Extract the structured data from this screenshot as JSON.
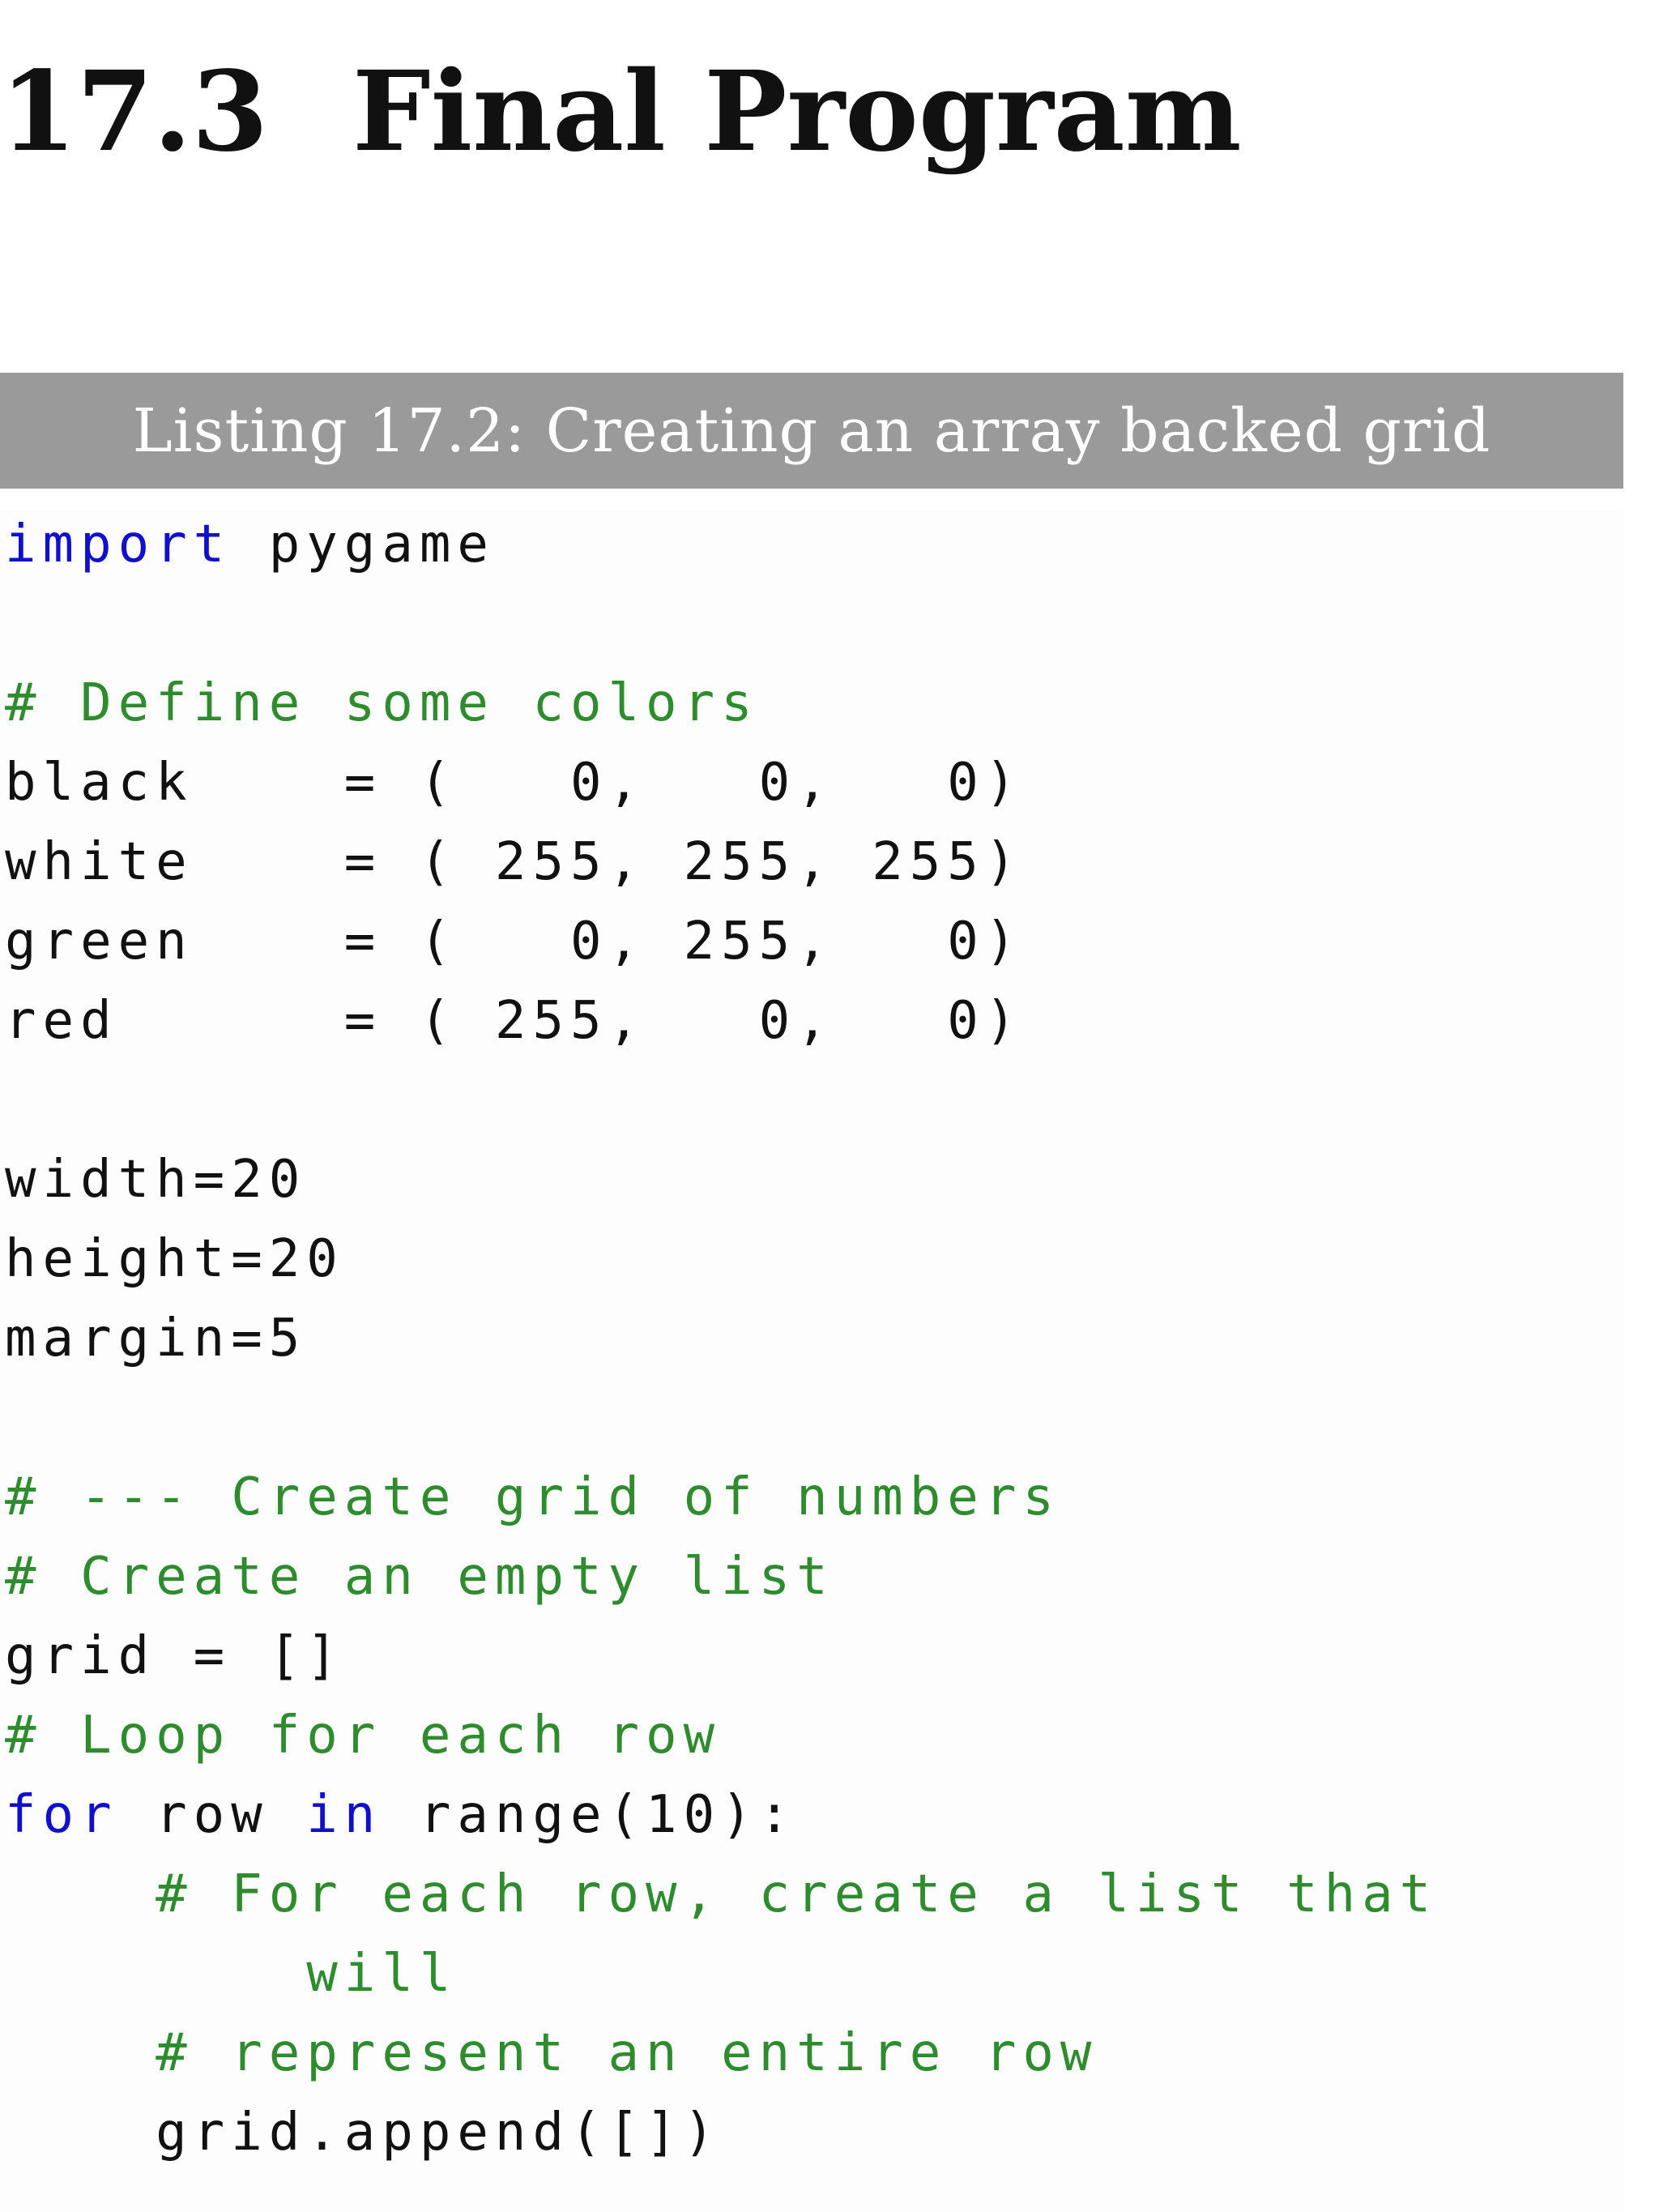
{
  "heading": {
    "number": "17.3",
    "title": "Final Program"
  },
  "listing": {
    "caption": "Listing 17.2: Creating an array backed grid"
  },
  "code": {
    "l01_kw": "import",
    "l01_rest": " pygame",
    "l02_cm": "# Define some colors",
    "l03": "black    = (   0,   0,   0)",
    "l04": "white    = ( 255, 255, 255)",
    "l05": "green    = (   0, 255,   0)",
    "l06": "red      = ( 255,   0,   0)",
    "l07": "width=20",
    "l08": "height=20",
    "l09": "margin=5",
    "l10_cm": "# --- Create grid of numbers",
    "l11_cm": "# Create an empty list",
    "l12": "grid = []",
    "l13_cm": "# Loop for each row",
    "l14_kw1": "for",
    "l14_mid": " row ",
    "l14_kw2": "in",
    "l14_rest": " range(10):",
    "l15_cm": "    # For each row, create a list that",
    "l16_cm": "        will",
    "l17_cm": "    # represent an entire row",
    "l18": "    grid.append([])"
  },
  "colors": {
    "keyword": "#1010cc",
    "comment": "#2e8b2e",
    "caption_bar": "#9a9a9a"
  }
}
